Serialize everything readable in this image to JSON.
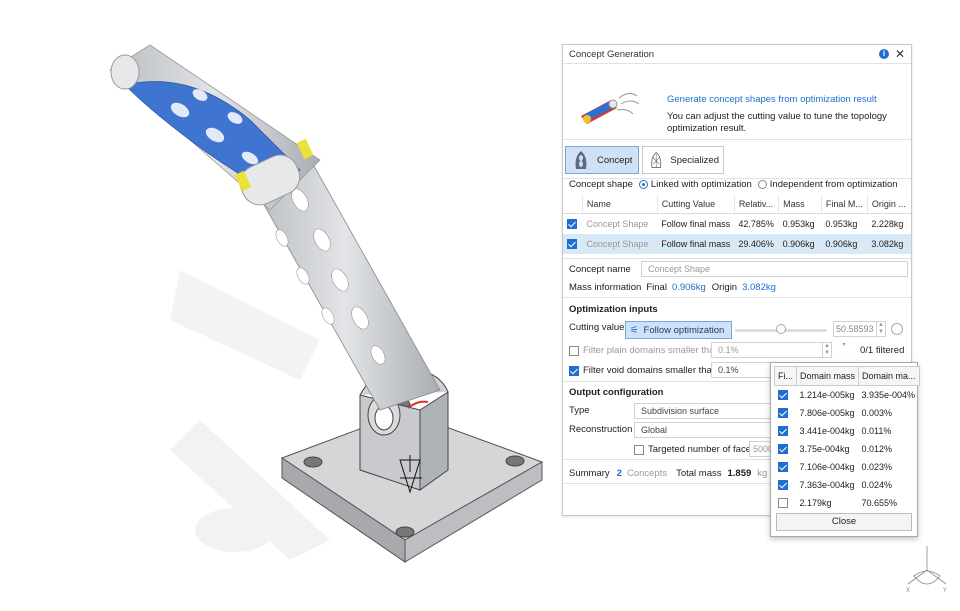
{
  "dialog": {
    "title": "Concept Generation",
    "header_link": "Generate concept shapes from optimization result",
    "header_desc": "You can adjust the cutting value to tune the topology optimization result.",
    "modes": [
      {
        "label": "Concept",
        "active": true
      },
      {
        "label": "Specialized",
        "active": false
      }
    ],
    "concept_shape": {
      "label": "Concept shape",
      "options": [
        {
          "label": "Linked with optimization",
          "selected": true
        },
        {
          "label": "Independent from optimization",
          "selected": false
        }
      ]
    },
    "table": {
      "columns": [
        "Name",
        "Cutting Value",
        "Relativ...",
        "Mass",
        "Final M...",
        "Origin ..."
      ],
      "rows": [
        {
          "checked": true,
          "name": "Concept Shape",
          "cutting": "Follow final mass",
          "relative": "42.785%",
          "mass": "0.953kg",
          "final": "0.953kg",
          "origin": "2.228kg",
          "selected": false
        },
        {
          "checked": true,
          "name": "Concept Shape",
          "cutting": "Follow final mass",
          "relative": "29.406%",
          "mass": "0.906kg",
          "final": "0.906kg",
          "origin": "3.082kg",
          "selected": true
        }
      ]
    },
    "concept_name": {
      "label": "Concept name",
      "placeholder": "Concept Shape"
    },
    "mass_info": {
      "label": "Mass information",
      "final_label": "Final",
      "final_value": "0.906kg",
      "origin_label": "Origin",
      "origin_value": "3.082kg"
    },
    "optimization_inputs": {
      "title": "Optimization inputs",
      "cutting_value_label": "Cutting value",
      "follow_button": "Follow optimization",
      "cutting_value": "50.58593",
      "filter_plain": {
        "label": "Filter plain domains smaller than",
        "checked": false,
        "value": "0.1%",
        "status": "0/1 filtered"
      },
      "filter_void": {
        "label": "Filter void domains smaller than",
        "checked": true,
        "value": "0.1%"
      }
    },
    "output": {
      "title": "Output configuration",
      "type_label": "Type",
      "type_value": "Subdivision surface",
      "reconstruction_label": "Reconstruction",
      "reconstruction_value": "Global",
      "targeted_faces_label": "Targeted number of faces",
      "targeted_faces_value": "5000"
    },
    "summary": {
      "label": "Summary",
      "count": "2",
      "concepts_label": "Concepts",
      "total_label": "Total mass",
      "total_value": "1.859",
      "unit": "kg"
    }
  },
  "popup": {
    "columns": [
      "Fi...",
      "Domain mass",
      "Domain ma..."
    ],
    "rows": [
      {
        "checked": true,
        "mass": "1.214e-005kg",
        "pct": "3.935e-004%"
      },
      {
        "checked": true,
        "mass": "7.806e-005kg",
        "pct": "0.003%"
      },
      {
        "checked": true,
        "mass": "3.441e-004kg",
        "pct": "0.011%"
      },
      {
        "checked": true,
        "mass": "3.75e-004kg",
        "pct": "0.012%"
      },
      {
        "checked": true,
        "mass": "7.106e-004kg",
        "pct": "0.023%"
      },
      {
        "checked": true,
        "mass": "7.363e-004kg",
        "pct": "0.024%"
      },
      {
        "checked": false,
        "mass": "2.179kg",
        "pct": "70.655%"
      }
    ],
    "close_label": "Close"
  },
  "colors": {
    "accent": "#1e6fd0",
    "selection": "#d7e8f7",
    "optimized_blue": "#3f74d1"
  }
}
